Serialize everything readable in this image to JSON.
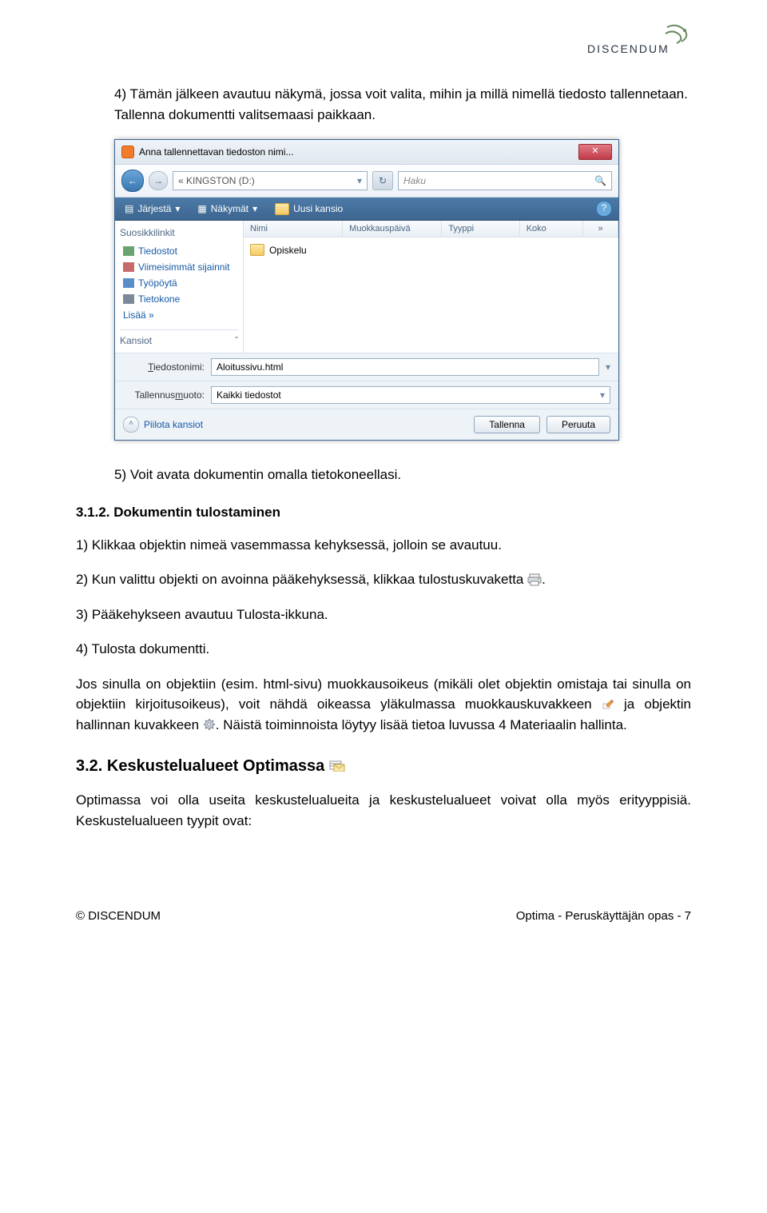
{
  "logo_text": "DISCENDUM",
  "body_text": {
    "item4": "4) Tämän jälkeen avautuu näkymä, jossa voit valita, mihin ja millä nimellä tiedosto tallennetaan. Tallenna dokumentti valitsemaasi paikkaan.",
    "item5": "5)  Voit avata dokumentin omalla tietokoneellasi.",
    "heading312": "3.1.2. Dokumentin tulostaminen",
    "step1": "1) Klikkaa objektin nimeä vasemmassa kehyksessä, jolloin se avautuu.",
    "step2a": "2) Kun valittu objekti on avoinna pääkehyksessä, klikkaa tulostuskuvaketta ",
    "step2b": ".",
    "step3": "3) Pääkehykseen avautuu Tulosta-ikkuna.",
    "step4": "4) Tulosta dokumentti.",
    "para_a1": "Jos sinulla on objektiin (esim. html-sivu) muokkausoikeus (mikäli olet objektin omistaja tai sinulla on objektiin kirjoitusoikeus), voit nähdä oikeassa yläkulmassa muokkauskuvakkeen ",
    "para_a2": " ja objektin hallinnan kuvakkeen ",
    "para_a3": ". Näistä toiminnoista löytyy lisää tietoa luvussa 4 Materiaalin hallinta.",
    "heading32": "3.2. Keskustelualueet Optimassa ",
    "para_b": "Optimassa voi olla useita keskustelualueita ja keskustelualueet voivat olla myös erityyppisiä. Keskustelualueen tyypit ovat:"
  },
  "dialog": {
    "title": "Anna tallennettavan tiedoston nimi...",
    "path": "« KINGSTON (D:)",
    "search_placeholder": "Haku",
    "toolbar": {
      "organize": "Järjestä",
      "views": "Näkymät",
      "newfolder": "Uusi kansio"
    },
    "sidebar": {
      "favorites": "Suosikkilinkit",
      "items": [
        "Tiedostot",
        "Viimeisimmät sijainnit",
        "Työpöytä",
        "Tietokone",
        "Lisää »"
      ],
      "folders": "Kansiot"
    },
    "columns": [
      "Nimi",
      "Muokkauspäivä",
      "Tyyppi",
      "Koko"
    ],
    "folder_item": "Opiskelu",
    "filename_label": "Tiedostonimi:",
    "filename_value": "Aloitussivu.html",
    "filetype_label": "Tallennusmuoto:",
    "filetype_value": "Kaikki tiedostot",
    "hide_folders": "Piilota kansiot",
    "save": "Tallenna",
    "cancel": "Peruuta"
  },
  "footer": {
    "left": "© DISCENDUM",
    "right": "Optima - Peruskäyttäjän opas - 7"
  }
}
